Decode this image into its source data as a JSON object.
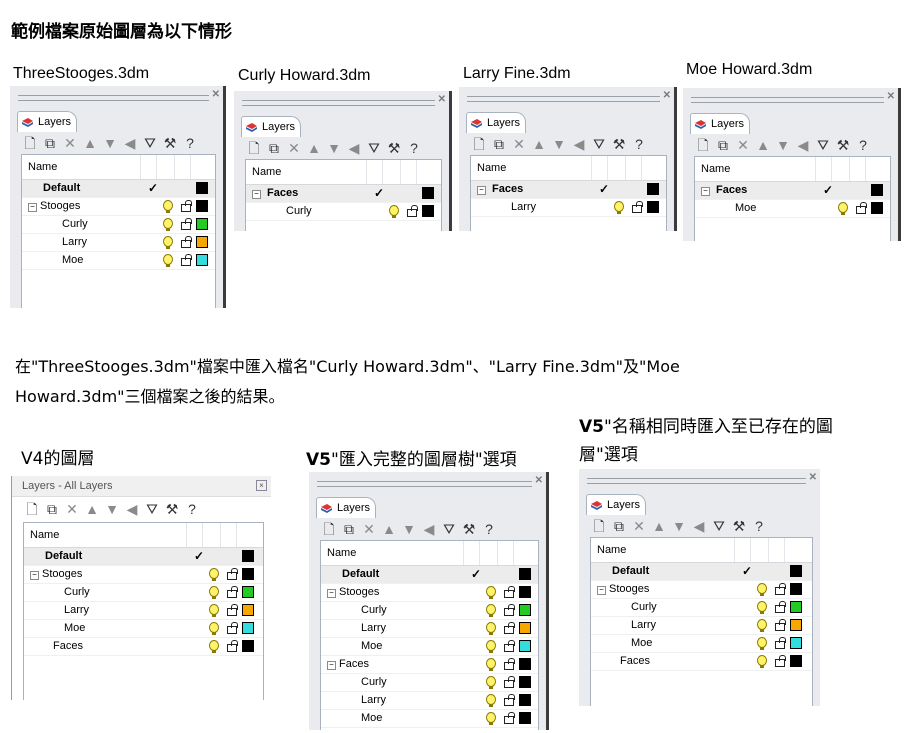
{
  "heading": "範例檔案原始圖層為以下情形",
  "layer_tab": "Layers",
  "col_name": "Name",
  "colors": {
    "black": "#000000",
    "green": "#22cc22",
    "orange": "#f5a800",
    "cyan": "#33dddd"
  },
  "files": [
    {
      "title": "ThreeStooges.3dm",
      "rows": [
        {
          "name": "Default",
          "sel": true,
          "current": true,
          "indent": 0,
          "color": "#000000"
        },
        {
          "name": "Stooges",
          "expander": "⊟",
          "indent": 0,
          "color": "#000000"
        },
        {
          "name": "Curly",
          "indent": 1,
          "color": "#22cc22"
        },
        {
          "name": "Larry",
          "indent": 1,
          "color": "#f5a800"
        },
        {
          "name": "Moe",
          "indent": 1,
          "color": "#33dddd"
        }
      ]
    },
    {
      "title": "Curly Howard.3dm",
      "rows": [
        {
          "name": "Faces",
          "sel": true,
          "current": true,
          "expander": "⊟",
          "indent": 0,
          "color": "#000000"
        },
        {
          "name": "Curly",
          "indent": 1,
          "color": "#000000"
        }
      ]
    },
    {
      "title": "Larry Fine.3dm",
      "rows": [
        {
          "name": "Faces",
          "sel": true,
          "current": true,
          "expander": "⊟",
          "indent": 0,
          "color": "#000000"
        },
        {
          "name": "Larry",
          "indent": 1,
          "color": "#000000"
        }
      ]
    },
    {
      "title": "Moe Howard.3dm",
      "rows": [
        {
          "name": "Faces",
          "sel": true,
          "current": true,
          "expander": "⊟",
          "indent": 0,
          "color": "#000000"
        },
        {
          "name": "Moe",
          "indent": 1,
          "color": "#000000"
        }
      ]
    }
  ],
  "paragraph_line1": "在\"ThreeStooges.3dm\"檔案中匯入檔名\"Curly Howard.3dm\"、\"Larry Fine.3dm\"及\"Moe",
  "paragraph_line2": "Howard.3dm\"三個檔案之後的結果。",
  "v4": {
    "caption": "V4的圖層",
    "title": "Layers - All Layers",
    "rows": [
      {
        "name": "Default",
        "sel": true,
        "current": true,
        "indent": 0,
        "color": "#000000"
      },
      {
        "name": "Stooges",
        "expander": "⊟",
        "indent": 0,
        "color": "#000000"
      },
      {
        "name": "Curly",
        "indent": 1,
        "color": "#22cc22"
      },
      {
        "name": "Larry",
        "indent": 1,
        "color": "#f5a800"
      },
      {
        "name": "Moe",
        "indent": 1,
        "color": "#33dddd"
      },
      {
        "name": "Faces",
        "indent": 0.5,
        "color": "#000000"
      }
    ]
  },
  "v5a": {
    "caption_bold": "V5",
    "caption_rest": "\"匯入完整的圖層樹\"選項",
    "rows": [
      {
        "name": "Default",
        "sel": true,
        "current": true,
        "indent": 0,
        "color": "#000000"
      },
      {
        "name": "Stooges",
        "expander": "⊟",
        "indent": 0,
        "color": "#000000"
      },
      {
        "name": "Curly",
        "indent": 1,
        "color": "#22cc22"
      },
      {
        "name": "Larry",
        "indent": 1,
        "color": "#f5a800"
      },
      {
        "name": "Moe",
        "indent": 1,
        "color": "#33dddd"
      },
      {
        "name": "Faces",
        "expander": "⊟",
        "indent": 0,
        "color": "#000000"
      },
      {
        "name": "Curly",
        "indent": 1,
        "color": "#000000"
      },
      {
        "name": "Larry",
        "indent": 1,
        "color": "#000000"
      },
      {
        "name": "Moe",
        "indent": 1,
        "color": "#000000"
      }
    ]
  },
  "v5b": {
    "caption_line1_bold": "V5",
    "caption_line1_rest": "\"名稱相同時匯入至已存在的圖",
    "caption_line2": "層\"選項",
    "rows": [
      {
        "name": "Default",
        "sel": true,
        "current": true,
        "indent": 0,
        "color": "#000000"
      },
      {
        "name": "Stooges",
        "expander": "⊟",
        "indent": 0,
        "color": "#000000"
      },
      {
        "name": "Curly",
        "indent": 1,
        "color": "#22cc22"
      },
      {
        "name": "Larry",
        "indent": 1,
        "color": "#f5a800"
      },
      {
        "name": "Moe",
        "indent": 1,
        "color": "#33dddd"
      },
      {
        "name": "Faces",
        "indent": 0.5,
        "color": "#000000"
      }
    ]
  },
  "icons": [
    "new-layer-icon",
    "new-sublayer-icon",
    "delete-icon",
    "move-up-icon",
    "move-down-icon",
    "move-parent-icon",
    "filter-icon",
    "tools-icon",
    "help-icon"
  ]
}
